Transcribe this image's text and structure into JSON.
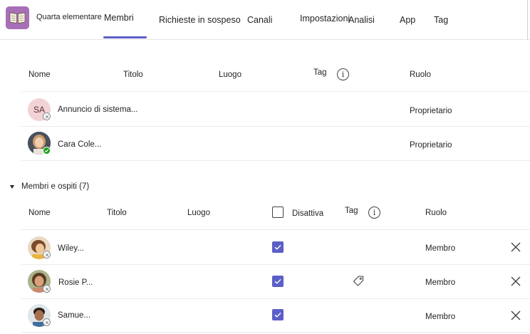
{
  "header": {
    "team_name": "Quarta elementare",
    "tabs": [
      "Membri",
      "Richieste in sospeso",
      "Canali",
      "Impostazioni",
      "Analisi",
      "App",
      "Tag"
    ],
    "active_tab": "Membri"
  },
  "owners_table": {
    "columns": {
      "name": "Nome",
      "title": "Titolo",
      "location": "Luogo",
      "tag": "Tag",
      "role": "Ruolo"
    },
    "rows": [
      {
        "initials": "SA",
        "name": "Annuncio di sistema...",
        "role": "Proprietario",
        "presence": "offline"
      },
      {
        "initials": "",
        "name": "Cara Cole...",
        "role": "Proprietario",
        "presence": "available"
      }
    ]
  },
  "members_section": {
    "label": "Membri e ospiti (7)",
    "columns": {
      "name": "Nome",
      "title": "Titolo",
      "location": "Luogo",
      "mute": "Disattiva",
      "tag": "Tag",
      "role": "Ruolo"
    },
    "rows": [
      {
        "name": "Wiley...",
        "role": "Membro",
        "muted": true,
        "has_tag_icon": false
      },
      {
        "name": "Rosie P...",
        "role": "Membro",
        "muted": true,
        "has_tag_icon": true
      },
      {
        "name": "Samue...",
        "role": "Membro",
        "muted": true,
        "has_tag_icon": false
      }
    ]
  },
  "icons": {
    "team_logo": "open-book-icon",
    "info": "info-icon",
    "tag": "tag-icon",
    "remove": "close-icon",
    "expand": "caret-down-icon"
  },
  "colors": {
    "accent": "#5b5fc7",
    "team_logo_bg": "#a66fb8",
    "available": "#13a10e"
  }
}
